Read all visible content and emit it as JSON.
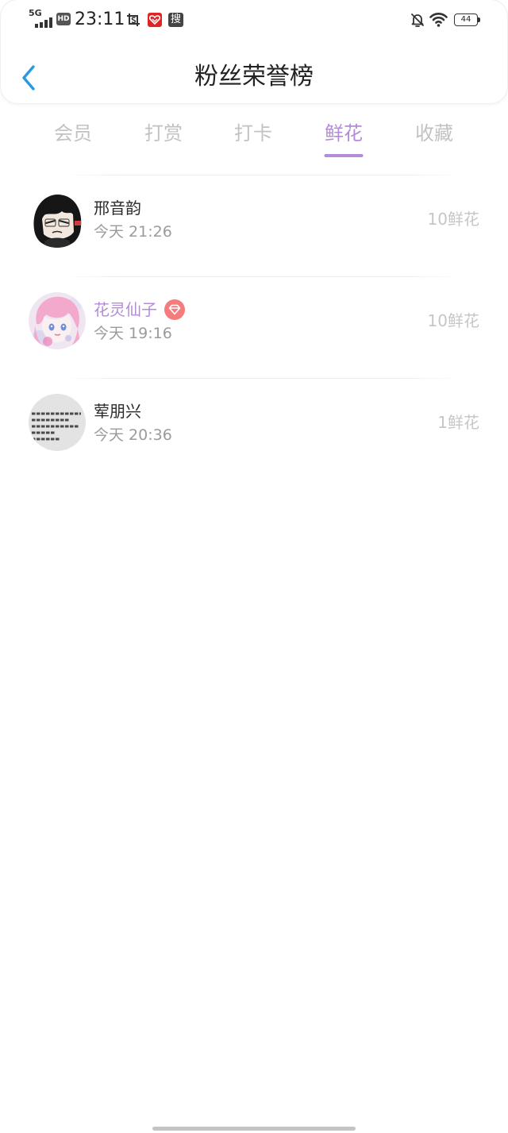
{
  "status_bar": {
    "network": "5G",
    "hd_badge": "HD",
    "time": "23:11",
    "search_badge": "搜",
    "battery": "44",
    "icons": [
      "signal-icon",
      "hd-icon",
      "screenshot-icon",
      "red-app-notification-icon",
      "search-app-icon",
      "bell-off-icon",
      "wifi-icon",
      "battery-icon"
    ]
  },
  "header": {
    "title": "粉丝荣誉榜",
    "back_icon": "chevron-left-icon"
  },
  "tabs": [
    {
      "label": "会员",
      "active": false
    },
    {
      "label": "打赏",
      "active": false
    },
    {
      "label": "打卡",
      "active": false
    },
    {
      "label": "鲜花",
      "active": true
    },
    {
      "label": "收藏",
      "active": false
    }
  ],
  "list": [
    {
      "name": "邢音韵",
      "time": "今天 21:26",
      "amount": "10鲜花",
      "vip": false,
      "avatar_icon": "anime-avatar-dark-hair"
    },
    {
      "name": "花灵仙子",
      "time": "今天 19:16",
      "amount": "10鲜花",
      "vip": true,
      "badge_icon": "diamond-icon",
      "avatar_icon": "anime-avatar-pink-hair"
    },
    {
      "name": "荤朋兴",
      "time": "今天 20:36",
      "amount": "1鲜花",
      "vip": false,
      "avatar_icon": "text-avatar"
    }
  ],
  "colors": {
    "accent": "#b48bd9",
    "back": "#2a9ae0",
    "vip_badge": "#f47c7c"
  }
}
